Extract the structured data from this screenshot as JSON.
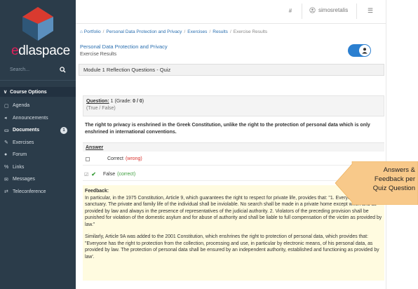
{
  "sidebar": {
    "brand": {
      "accent": "e",
      "rest": "dlaspace"
    },
    "search_placeholder": "Search...",
    "course_options_label": "Course Options",
    "items": [
      {
        "label": "Agenda",
        "icon": "calendar-icon",
        "glyph": "▢"
      },
      {
        "label": "Announcements",
        "icon": "megaphone-icon",
        "glyph": "◂"
      },
      {
        "label": "Documents",
        "icon": "folder-icon",
        "glyph": "▭",
        "badge": "1"
      },
      {
        "label": "Exercises",
        "icon": "edit-icon",
        "glyph": "✎"
      },
      {
        "label": "Forum",
        "icon": "comments-icon",
        "glyph": "●"
      },
      {
        "label": "Links",
        "icon": "link-icon",
        "glyph": "%"
      },
      {
        "label": "Messages",
        "icon": "envelope-icon",
        "glyph": "✉"
      },
      {
        "label": "Teleconference",
        "icon": "exchange-icon",
        "glyph": "⇄"
      }
    ]
  },
  "topbar": {
    "username": "simosretalis"
  },
  "breadcrumb": {
    "items": [
      "Portfolio",
      "Personal Data Protection and Privacy",
      "Exercises",
      "Results"
    ],
    "current": "Exercise Results"
  },
  "page": {
    "title": "Personal Data Protection and Privacy",
    "subtitle": "Exercise Results",
    "quiz_title": "Module 1 Reflection Questions - Quiz"
  },
  "question": {
    "label": "Question:",
    "number": "1",
    "grade_text": "(Grade: ",
    "grade": "0 / 0",
    "grade_close": ")",
    "type": "(True / False)",
    "text": "The right to privacy is enshrined in the Greek Constitution, unlike the right to the protection of personal data which is only enshrined in international conventions.",
    "answer_label": "Answer",
    "answers": [
      {
        "label": "Correct",
        "verdict": "(wrong)",
        "selected": false
      },
      {
        "label": "False",
        "verdict": "(correct)",
        "selected": true
      }
    ]
  },
  "feedback": {
    "label": "Feedback:",
    "paragraph1": "In particular, in the 1975 Constitution, Article 9, which guarantees the right to respect for private life, provides that: \"1. Everyone's home is a sanctuary. The private and family life of the individual shall be inviolable. No search shall be made in a private home except when and as provided by law and always in the presence of representatives of the judicial authority. 2. Violators of the preceding provision shall be punished for violation of the domestic asylum and for abuse of authority and shall be liable to full compensation of the victim as provided by law.\"",
    "paragraph2": "Similarly, Article 9A was added to the 2001 Constitution, which enshrines the right to protection of personal data, which provides that: \"Everyone has the right to protection from the collection, processing and use, in particular by electronic means, of his personal data, as provided by law. The protection of personal data shall be ensured by an independent authority, established and functioning as provided by law'."
  },
  "callout": {
    "lines": [
      "Answers &",
      "Feedback per",
      "Quiz Question"
    ]
  },
  "colors": {
    "sidebar_bg": "#2b3c4a",
    "brand_accent": "#e0205a",
    "link_blue": "#2a6fb0",
    "toggle_blue": "#2b7fd0",
    "wrong_red": "#d9302b",
    "correct_green": "#3a9c3a",
    "feedback_bg": "#fffbe0",
    "callout_orange": "#f8c98a"
  }
}
